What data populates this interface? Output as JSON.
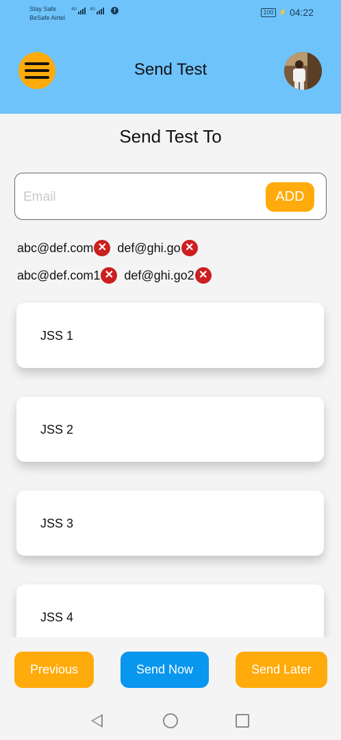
{
  "status_bar": {
    "carrier_line1": "Stay Safe",
    "carrier_line2": "BeSafe Airtel",
    "signal_label_1": "4G",
    "signal_label_2": "4G",
    "battery": "100",
    "time": "04:22",
    "icons": [
      "signal-icon",
      "signal-icon",
      "facebook-icon",
      "battery-icon",
      "charging-icon"
    ]
  },
  "header": {
    "title": "Send Test",
    "menu_icon": "hamburger-menu-icon",
    "avatar": "profile-avatar",
    "background": "#6ec3fb"
  },
  "main": {
    "section_title": "Send Test To",
    "email_placeholder": "Email",
    "add_label": "ADD",
    "emails": [
      [
        "abc@def.com",
        "def@ghi.go"
      ],
      [
        "abc@def.com1",
        "def@ghi.go2"
      ]
    ],
    "remove_icon": "remove-circle-icon",
    "tests": [
      "JSS 1",
      "JSS 2",
      "JSS 3",
      "JSS 4"
    ]
  },
  "footer": {
    "previous_label": "Previous",
    "send_now_label": "Send Now",
    "send_later_label": "Send Later"
  },
  "nav": {
    "icons": [
      "back-icon",
      "home-icon",
      "recent-apps-icon"
    ]
  },
  "colors": {
    "accent_orange": "#ffab0b",
    "accent_blue": "#0996ee",
    "remove_red": "#cc1f1f"
  }
}
